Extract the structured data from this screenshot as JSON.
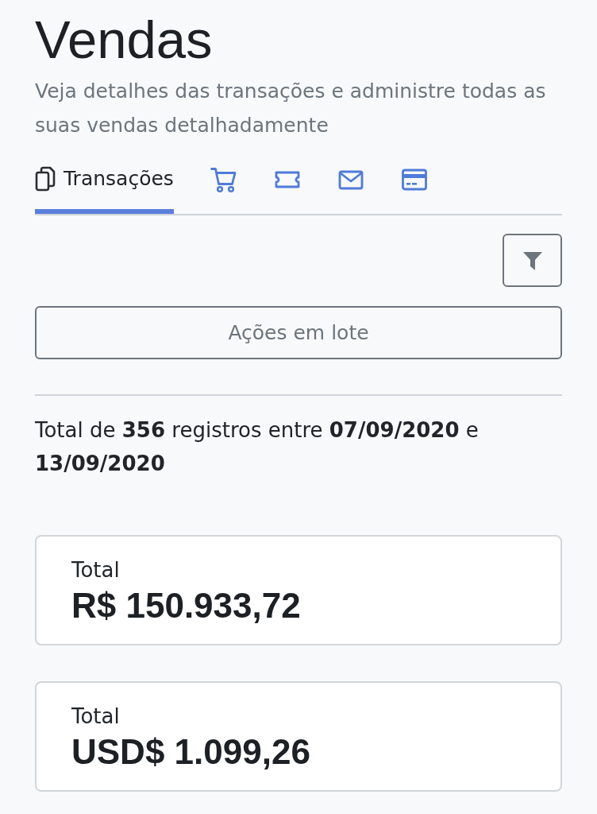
{
  "page": {
    "title": "Vendas",
    "subtitle": "Veja detalhes das transações e administre todas as suas vendas detalhadamente"
  },
  "tabs": [
    {
      "label": "Transações",
      "selected": true
    },
    {
      "selected": false
    },
    {
      "selected": false
    },
    {
      "selected": false
    },
    {
      "selected": false
    }
  ],
  "toolbar": {
    "batch_button": "Ações em lote"
  },
  "summary": "Total de **356** registros entre **07/09/2020** e **13/09/2020**",
  "totals": [
    {
      "label": "Total",
      "amount": "R$ 150.933,72"
    },
    {
      "label": "Total",
      "amount": "USD$ 1.099,26"
    }
  ]
}
